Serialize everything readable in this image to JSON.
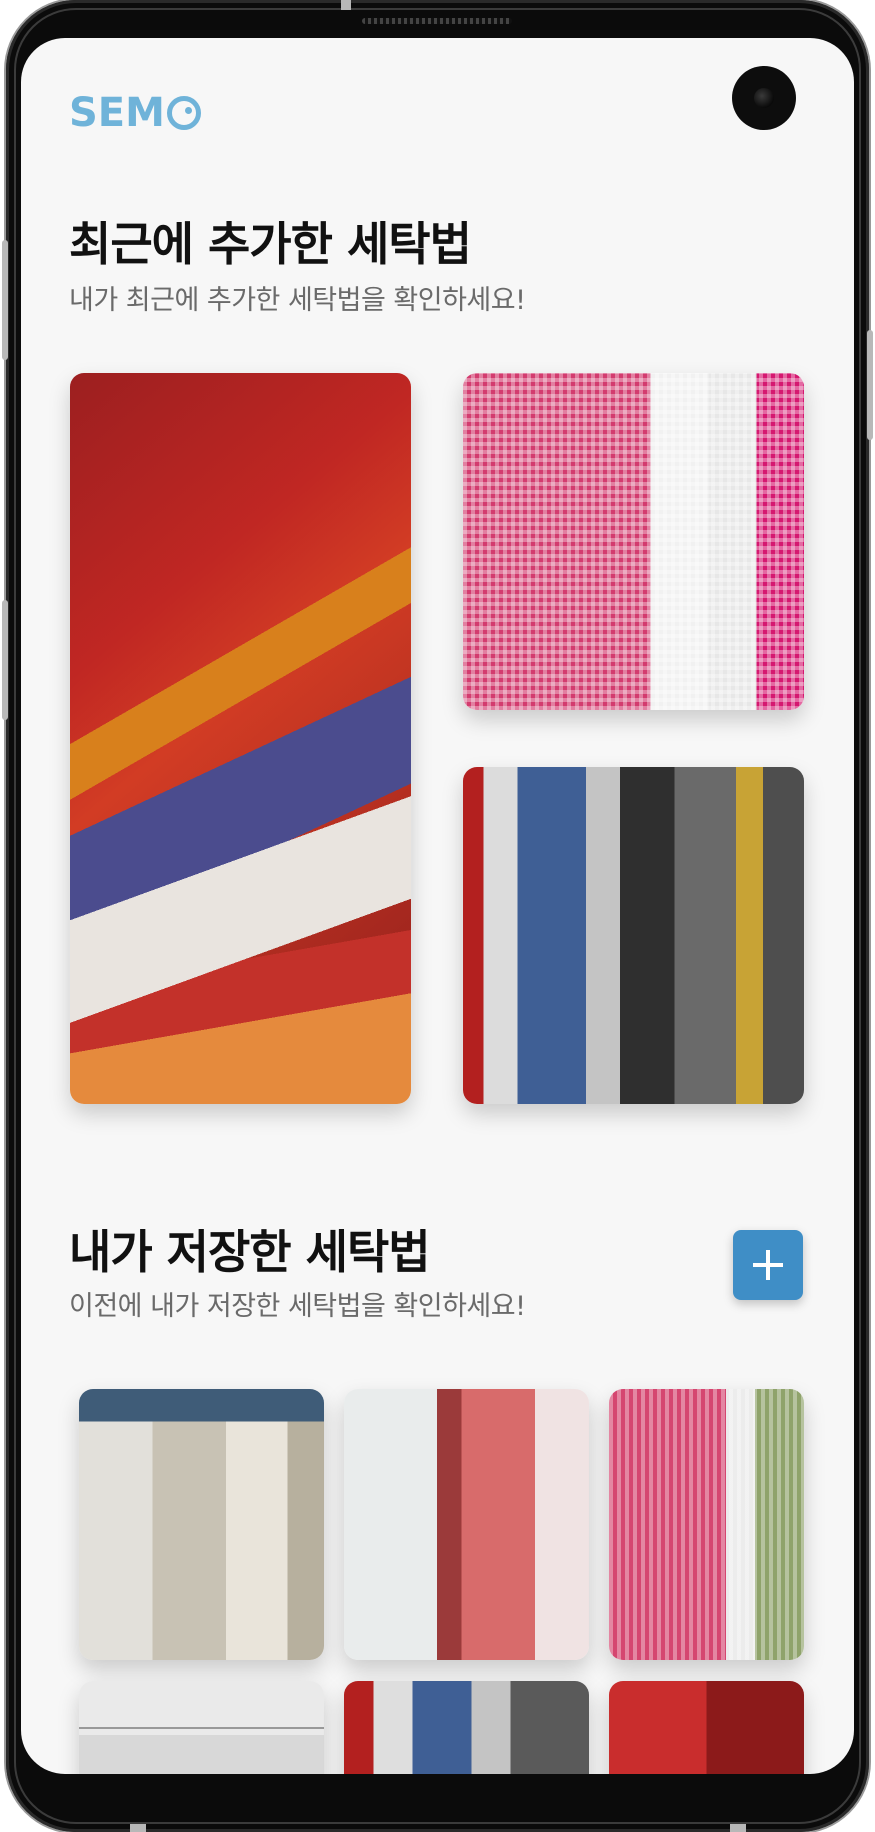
{
  "app": {
    "logo_text": "SEM"
  },
  "recent": {
    "title": "최근에 추가한 세탁법",
    "subtitle": "내가 최근에 추가한 세탁법을 확인하세요!",
    "photos": [
      "laundry-clothesline-photo",
      "checked-apron-photo",
      "hanging-clothes-photo"
    ]
  },
  "saved": {
    "title": "내가 저장한 세탁법",
    "subtitle": "이전에 내가 저장한 세탁법을 확인하세요!",
    "add_icon": "plus-icon",
    "photos": [
      "white-shirts-photo",
      "pink-shirt-photo",
      "checked-apron-photo",
      "hangers-photo",
      "hanging-clothes-photo",
      "red-towel-photo"
    ]
  },
  "colors": {
    "accent": "#3f8ec6",
    "logo": "#6fb3d9"
  }
}
